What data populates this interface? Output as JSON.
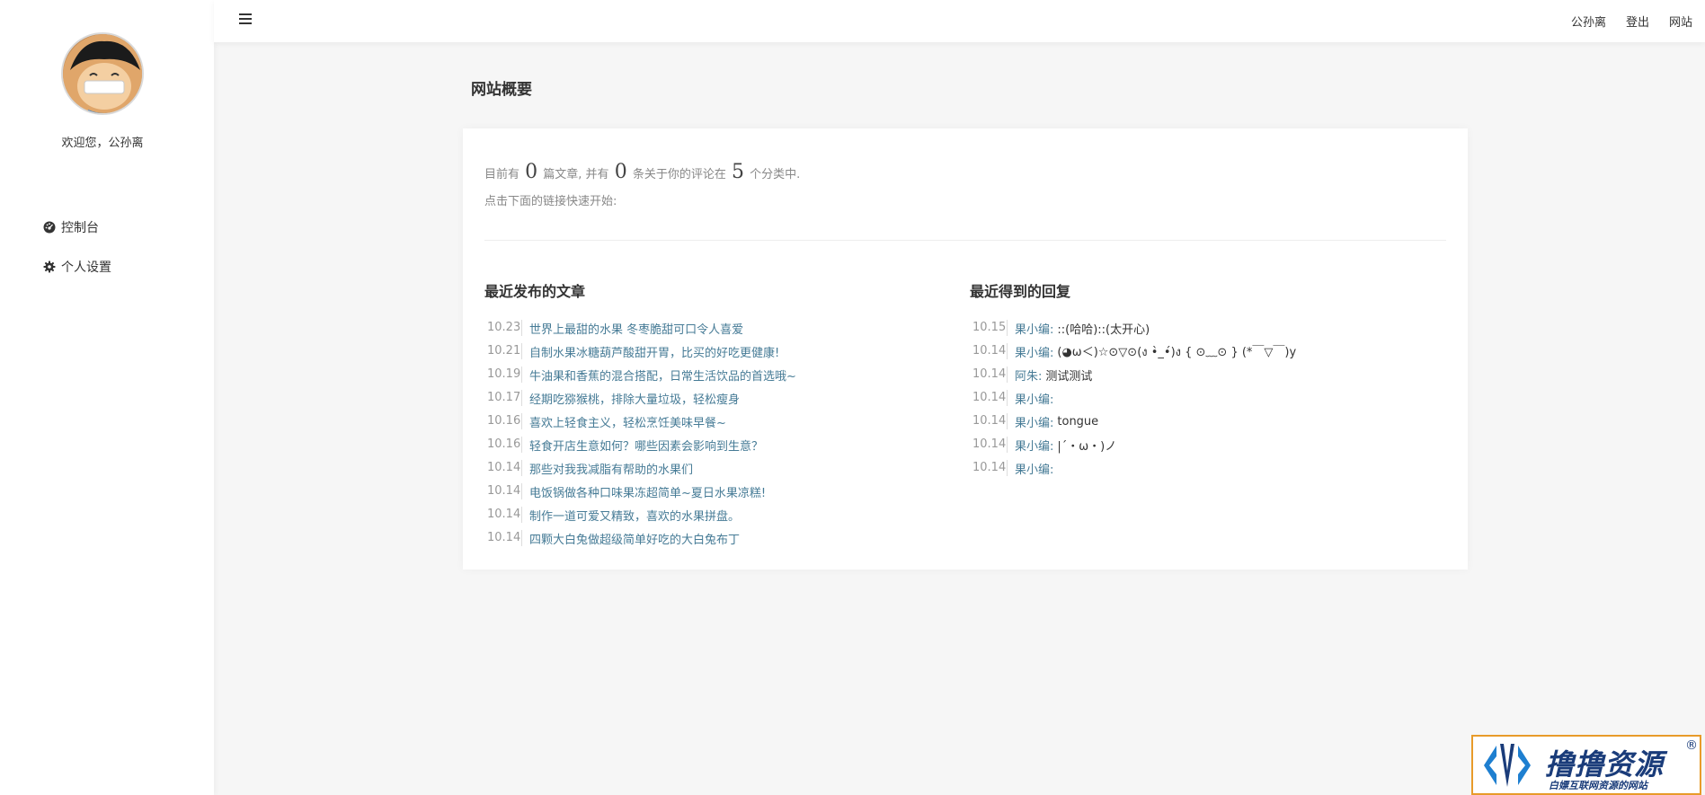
{
  "sidebar": {
    "welcome": "欢迎您，公孙离",
    "items": [
      {
        "label": "控制台",
        "icon": "dashboard-icon"
      },
      {
        "label": "个人设置",
        "icon": "gear-icon"
      }
    ]
  },
  "topbar": {
    "menu_icon": "hamburger-icon",
    "links": [
      "公孙离",
      "登出",
      "网站"
    ]
  },
  "main": {
    "title": "网站概要",
    "stats": {
      "prefix": "目前有",
      "posts": "0",
      "mid1": "篇文章, 并有",
      "comments": "0",
      "mid2": "条关于你的评论在",
      "categories": "5",
      "suffix": "个分类中."
    },
    "hint": "点击下面的链接快速开始:",
    "recent_posts": {
      "heading": "最近发布的文章",
      "items": [
        {
          "date": "10.23",
          "title": "世界上最甜的水果 冬枣脆甜可口令人喜爱"
        },
        {
          "date": "10.21",
          "title": "自制水果冰糖葫芦酸甜开胃，比买的好吃更健康!"
        },
        {
          "date": "10.19",
          "title": "牛油果和香蕉的混合搭配，日常生活饮品的首选哦~"
        },
        {
          "date": "10.17",
          "title": "经期吃猕猴桃，排除大量垃圾，轻松瘦身"
        },
        {
          "date": "10.16",
          "title": "喜欢上轻食主义，轻松烹饪美味早餐~"
        },
        {
          "date": "10.16",
          "title": "轻食开店生意如何？哪些因素会影响到生意？"
        },
        {
          "date": "10.14",
          "title": "那些对我我减脂有帮助的水果们"
        },
        {
          "date": "10.14",
          "title": "电饭锅做各种口味果冻超简单~夏日水果凉糕!"
        },
        {
          "date": "10.14",
          "title": "制作一道可爱又精致，喜欢的水果拼盘。"
        },
        {
          "date": "10.14",
          "title": "四颗大白兔做超级简单好吃的大白兔布丁"
        }
      ]
    },
    "recent_replies": {
      "heading": "最近得到的回复",
      "items": [
        {
          "date": "10.15",
          "author": "果小编:",
          "text": "::(哈哈)::(太开心)"
        },
        {
          "date": "10.14",
          "author": "果小编:",
          "text": "(◕ω＜)☆⊙▽⊙(ง •̀_•́)ง { ⊙﹏⊙ } (*￣▽￣)y"
        },
        {
          "date": "10.14",
          "author": "阿朱:",
          "text": "测试测试"
        },
        {
          "date": "10.14",
          "author": "果小编:",
          "text": ""
        },
        {
          "date": "10.14",
          "author": "果小编:",
          "text": "tongue"
        },
        {
          "date": "10.14",
          "author": "果小编:",
          "text": "|´・ω・)ノ"
        },
        {
          "date": "10.14",
          "author": "果小编:",
          "text": ""
        }
      ]
    }
  },
  "watermark": {
    "name": "撸撸资源",
    "reg": "®",
    "slogan": "白嫖互联网资源的网站"
  },
  "colors": {
    "link": "#467b96",
    "watermark_border": "#e89b2a",
    "watermark_text": "#1a3c7a"
  }
}
